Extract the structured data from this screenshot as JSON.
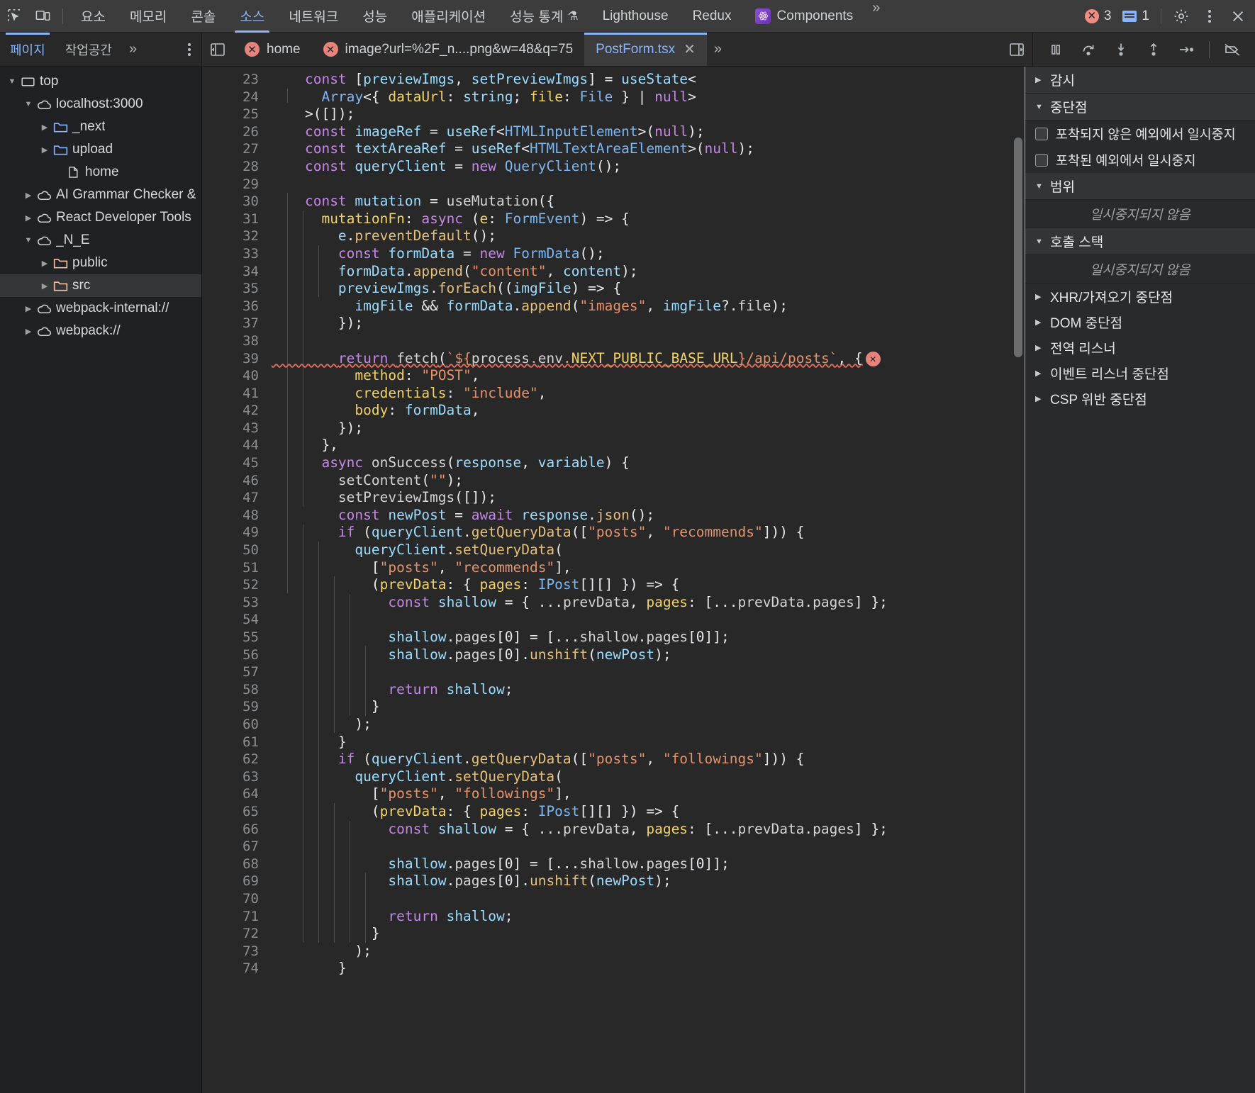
{
  "top_toolbar": {
    "inspect_icon": "inspect-element-icon",
    "device_icon": "device-toolbar-icon",
    "tabs": [
      {
        "label": "요소",
        "active": false
      },
      {
        "label": "메모리",
        "active": false
      },
      {
        "label": "콘솔",
        "active": false
      },
      {
        "label": "소스",
        "active": true
      },
      {
        "label": "네트워크",
        "active": false
      },
      {
        "label": "성능",
        "active": false
      },
      {
        "label": "애플리케이션",
        "active": false
      },
      {
        "label": "성능 통계",
        "active": false,
        "suffix": "⚗"
      },
      {
        "label": "Lighthouse",
        "active": false
      },
      {
        "label": "Redux",
        "active": false
      },
      {
        "label": "Components",
        "active": false,
        "badge": "react-logo-icon"
      }
    ],
    "more_tabs": "»",
    "error_count": "3",
    "warning_count": "1",
    "settings_icon": "gear-icon",
    "menu_icon": "kebab-menu-icon",
    "close_icon": "close-icon"
  },
  "nav_pane": {
    "tabs": [
      {
        "label": "페이지",
        "active": true
      },
      {
        "label": "작업공간",
        "active": false
      }
    ],
    "more": "»",
    "menu_icon": "kebab-menu-icon"
  },
  "editor_tabs": {
    "panel_toggle_icon": "toggle-navigator-icon",
    "tabs": [
      {
        "label": "home",
        "error": true,
        "active": false,
        "closable": false
      },
      {
        "label": "image?url=%2F_n....png&w=48&q=75",
        "error": true,
        "active": false,
        "closable": false
      },
      {
        "label": "PostForm.tsx",
        "error": false,
        "active": true,
        "closable": true
      }
    ],
    "more": "»",
    "right_panel_toggle_icon": "toggle-debugger-icon"
  },
  "debug_toolbar": {
    "buttons": [
      {
        "name": "pause-resume-button",
        "icon": "pause-icon"
      },
      {
        "name": "step-over-button",
        "icon": "step-over-icon"
      },
      {
        "name": "step-into-button",
        "icon": "step-into-icon"
      },
      {
        "name": "step-out-button",
        "icon": "step-out-icon"
      },
      {
        "name": "step-button",
        "icon": "step-icon"
      },
      {
        "name": "deactivate-breakpoints-button",
        "icon": "deactivate-breakpoints-icon"
      }
    ]
  },
  "file_tree": [
    {
      "label": "top",
      "icon": "frame-icon",
      "indent": 0,
      "twisty": "down",
      "selected": false
    },
    {
      "label": "localhost:3000",
      "icon": "cloud-icon",
      "indent": 1,
      "twisty": "down",
      "selected": false
    },
    {
      "label": "_next",
      "icon": "folder-blue-icon",
      "indent": 2,
      "twisty": "right",
      "selected": false
    },
    {
      "label": "upload",
      "icon": "folder-blue-icon",
      "indent": 2,
      "twisty": "right",
      "selected": false
    },
    {
      "label": "home",
      "icon": "file-icon",
      "indent": 2,
      "twisty": "none",
      "selected": false
    },
    {
      "label": "AI Grammar Checker &",
      "icon": "cloud-icon",
      "indent": 1,
      "twisty": "right",
      "selected": false
    },
    {
      "label": "React Developer Tools",
      "icon": "cloud-icon",
      "indent": 1,
      "twisty": "right",
      "selected": false
    },
    {
      "label": "_N_E",
      "icon": "cloud-icon",
      "indent": 1,
      "twisty": "down",
      "selected": false
    },
    {
      "label": "public",
      "icon": "folder-orange-icon",
      "indent": 2,
      "twisty": "right",
      "selected": false
    },
    {
      "label": "src",
      "icon": "folder-orange-icon",
      "indent": 2,
      "twisty": "right",
      "selected": true
    },
    {
      "label": "webpack-internal://",
      "icon": "cloud-icon",
      "indent": 1,
      "twisty": "right",
      "selected": false
    },
    {
      "label": "webpack://",
      "icon": "cloud-icon",
      "indent": 1,
      "twisty": "right",
      "selected": false
    }
  ],
  "code": {
    "first_line": 23,
    "last_line": 74,
    "lines": [
      "    const [previewImgs, setPreviewImgs] = useState<",
      "      Array<{ dataUrl: string; file: File } | null>",
      "    >([]);",
      "    const imageRef = useRef<HTMLInputElement>(null);",
      "    const textAreaRef = useRef<HTMLTextAreaElement>(null);",
      "    const queryClient = new QueryClient();",
      "",
      "    const mutation = useMutation({",
      "      mutationFn: async (e: FormEvent) => {",
      "        e.preventDefault();",
      "        const formData = new FormData();",
      "        formData.append(\"content\", content);",
      "        previewImgs.forEach((imgFile) => {",
      "          imgFile && formData.append(\"images\", imgFile?.file);",
      "        });",
      "",
      "        return fetch(`${process.env.NEXT_PUBLIC_BASE_URL}/api/posts`, {",
      "          method: \"POST\",",
      "          credentials: \"include\",",
      "          body: formData,",
      "        });",
      "      },",
      "      async onSuccess(response, variable) {",
      "        setContent(\"\");",
      "        setPreviewImgs([]);",
      "        const newPost = await response.json();",
      "        if (queryClient.getQueryData([\"posts\", \"recommends\"])) {",
      "          queryClient.setQueryData(",
      "            [\"posts\", \"recommends\"],",
      "            (prevData: { pages: IPost[][] }) => {",
      "              const shallow = { ...prevData, pages: [...prevData.pages] };",
      "",
      "              shallow.pages[0] = [...shallow.pages[0]];",
      "              shallow.pages[0].unshift(newPost);",
      "",
      "              return shallow;",
      "            }",
      "          );",
      "        }",
      "        if (queryClient.getQueryData([\"posts\", \"followings\"])) {",
      "          queryClient.setQueryData(",
      "            [\"posts\", \"followings\"],",
      "            (prevData: { pages: IPost[][] }) => {",
      "              const shallow = { ...prevData, pages: [...prevData.pages] };",
      "",
      "              shallow.pages[0] = [...shallow.pages[0]];",
      "              shallow.pages[0].unshift(newPost);",
      "",
      "              return shallow;",
      "            }",
      "          );",
      "        }"
    ],
    "error_marker_line": 39,
    "error_marker_glyph": "✕"
  },
  "debugger_panel": {
    "sections": [
      {
        "label": "감시",
        "expanded": false,
        "type": "section"
      },
      {
        "label": "중단점",
        "expanded": true,
        "type": "section"
      },
      {
        "label": "포착되지 않은 예외에서 일시중지",
        "type": "checkbox",
        "checked": false
      },
      {
        "label": "포착된 예외에서 일시중지",
        "type": "checkbox",
        "checked": false
      },
      {
        "label": "범위",
        "expanded": true,
        "type": "section"
      },
      {
        "label": "일시중지되지 않음",
        "type": "empty"
      },
      {
        "label": "호출 스택",
        "expanded": true,
        "type": "section"
      },
      {
        "label": "일시중지되지 않음",
        "type": "empty"
      },
      {
        "label": "XHR/가져오기 중단점",
        "expanded": false,
        "type": "item"
      },
      {
        "label": "DOM 중단점",
        "expanded": false,
        "type": "item"
      },
      {
        "label": "전역 리스너",
        "expanded": false,
        "type": "item"
      },
      {
        "label": "이벤트 리스너 중단점",
        "expanded": false,
        "type": "item"
      },
      {
        "label": "CSP 위반 중단점",
        "expanded": false,
        "type": "item"
      }
    ]
  },
  "colors": {
    "accent": "#8ab4f8",
    "error": "#f28b82",
    "editor_bg": "#282828",
    "panel_bg": "#292a2d",
    "toolbar_bg": "#3c3c3c"
  }
}
